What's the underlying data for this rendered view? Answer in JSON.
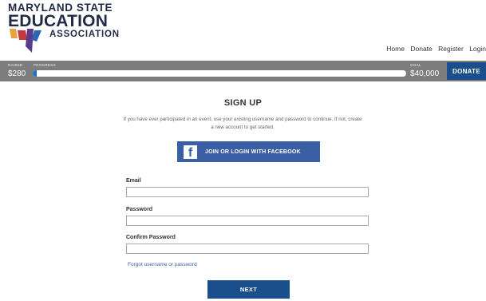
{
  "brand": {
    "line1": "MARYLAND STATE",
    "line2": "EDUCATION",
    "line3": "ASSOCIATION",
    "colors": {
      "navy": "#1f2a44",
      "orange": "#e8a33a",
      "red": "#c8373f",
      "purple": "#5a3b8c",
      "blue": "#2a67b2"
    }
  },
  "nav": {
    "items": [
      "Home",
      "Donate",
      "Register",
      "Login"
    ]
  },
  "fundraiser": {
    "raised_label": "RAISED",
    "raised_value": "$280",
    "progress_label": "PROGRESS",
    "progress_fraction": 0.007,
    "goal_label": "GOAL",
    "goal_value": "$40,000",
    "donate_label": "DONATE"
  },
  "signup": {
    "title": "SIGN UP",
    "intro": "If you have ever participated in an event, use your existing username and password to continue. If not, create a new account to get started.",
    "facebook_button": "JOIN OR LOGIN WITH FACEBOOK",
    "facebook_icon": "f",
    "email_label": "Email",
    "email_value": "",
    "password_label": "Password",
    "password_value": "",
    "confirm_label": "Confirm Password",
    "confirm_value": "",
    "forgot_link": "Forgot username or password",
    "next_button": "NEXT"
  }
}
